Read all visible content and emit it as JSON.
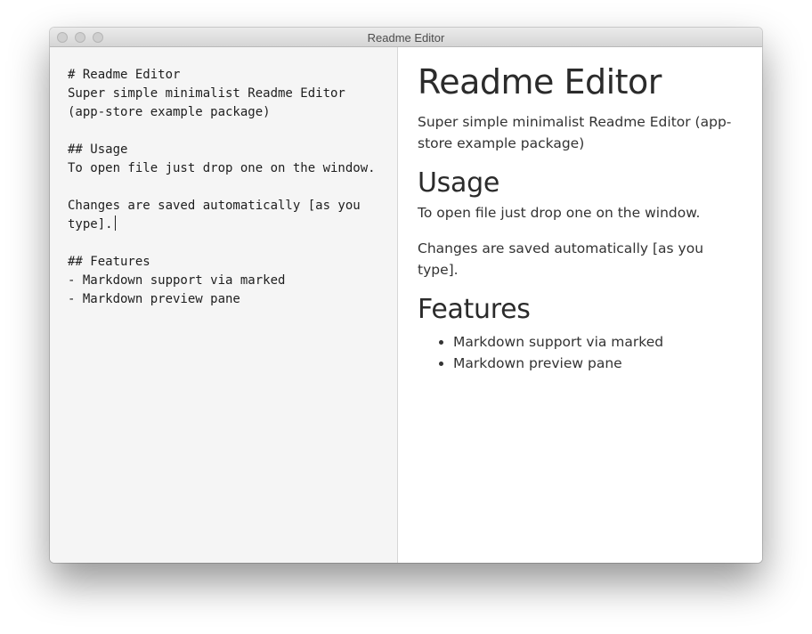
{
  "window": {
    "title": "Readme Editor"
  },
  "editor": {
    "lines": [
      "# Readme Editor",
      "Super simple minimalist Readme Editor (app-store example package)",
      "",
      "## Usage",
      "To open file just drop one on the window.",
      "",
      "Changes are saved automatically [as you type].",
      "",
      "## Features",
      "- Markdown support via marked",
      "- Markdown preview pane"
    ]
  },
  "preview": {
    "h1": "Readme Editor",
    "intro": "Super simple minimalist Readme Editor (app-store example package)",
    "usage_heading": "Usage",
    "usage_p1": "To open file just drop one on the window.",
    "usage_p2": "Changes are saved automatically [as you type].",
    "features_heading": "Features",
    "features": [
      "Markdown support via marked",
      "Markdown preview pane"
    ]
  },
  "colors": {
    "editor_background": "#f5f5f5",
    "preview_background": "#ffffff",
    "titlebar": "#dcdcdc"
  }
}
